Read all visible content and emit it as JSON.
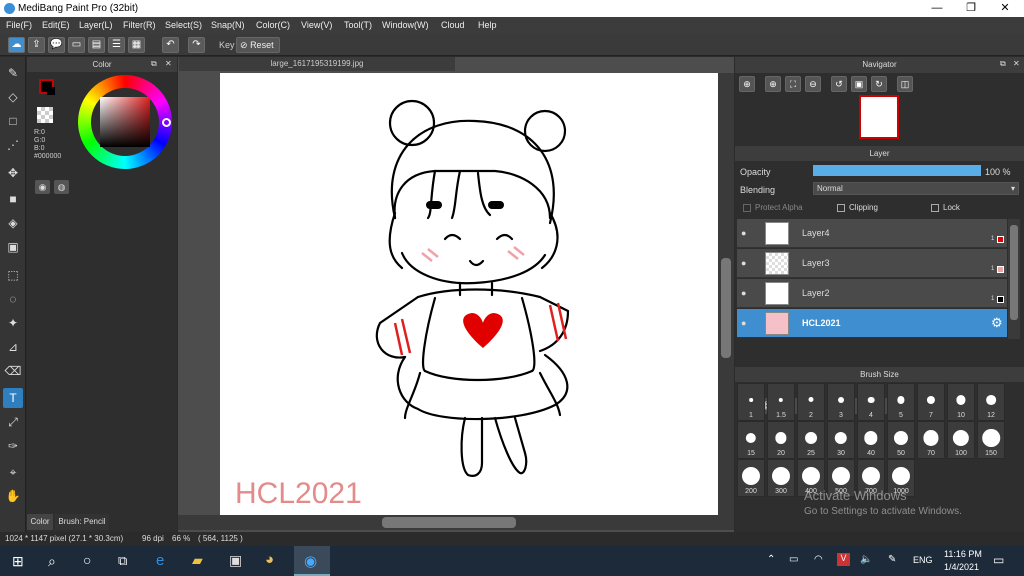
{
  "window": {
    "title": "MediBang Paint Pro (32bit)",
    "minimize": "—",
    "maximize": "❐",
    "close": "✕"
  },
  "menu": [
    "File(F)",
    "Edit(E)",
    "Layer(L)",
    "Filter(R)",
    "Select(S)",
    "Snap(N)",
    "Color(C)",
    "View(V)",
    "Tool(T)",
    "Window(W)",
    "Cloud",
    "Help"
  ],
  "toolbar": {
    "key_label": "Key",
    "reset_label": "Reset",
    "icons": [
      "cloud-icon",
      "share-icon",
      "comment-icon",
      "chat-icon",
      "document-icon",
      "list-icon",
      "grid-icon",
      "undo-icon",
      "redo-icon"
    ]
  },
  "color_panel": {
    "title": "Color",
    "rgb": [
      "R:0",
      "G:0",
      "B:0"
    ],
    "hex": "#000000",
    "primary": "#000000",
    "secondary": "#ffffff"
  },
  "document": {
    "tab": "large_1617195319199.jpg",
    "signature": "HCL2021"
  },
  "navigator": {
    "title": "Navigator"
  },
  "layer_panel": {
    "title": "Layer",
    "opacity_label": "Opacity",
    "opacity_value": "100 %",
    "opacity": 1.0,
    "blending_label": "Blending",
    "blending_value": "Normal",
    "protect_alpha": "Protect Alpha",
    "clipping": "Clipping",
    "lock": "Lock",
    "layers": [
      {
        "name": "Layer4",
        "num": "1",
        "color": "#e00000"
      },
      {
        "name": "Layer3",
        "num": "1",
        "color": "#f0a0a0"
      },
      {
        "name": "Layer2",
        "num": "1",
        "color": "#000000"
      },
      {
        "name": "HCL2021",
        "num": "",
        "color": ""
      }
    ]
  },
  "brush_panel": {
    "title": "Brush Size",
    "sizes": [
      "1",
      "1.5",
      "2",
      "3",
      "4",
      "5",
      "7",
      "10",
      "12",
      "15",
      "20",
      "25",
      "30",
      "40",
      "50",
      "70",
      "100",
      "150",
      "200",
      "300",
      "400",
      "500",
      "700",
      "1000"
    ]
  },
  "bottom_tabs": {
    "color": "Color",
    "brush": "Brush: Pencil"
  },
  "status": {
    "size": "1024 * 1147 pixel  (27.1 * 30.3cm)",
    "dpi": "96 dpi",
    "zoom": "66 %",
    "coords": "( 564, 1125 )"
  },
  "watermark": {
    "line1": "Activate Windows",
    "line2": "Go to Settings to activate Windows."
  },
  "taskbar": {
    "lang": "ENG",
    "time": "11:16 PM",
    "date": "1/4/2021"
  }
}
